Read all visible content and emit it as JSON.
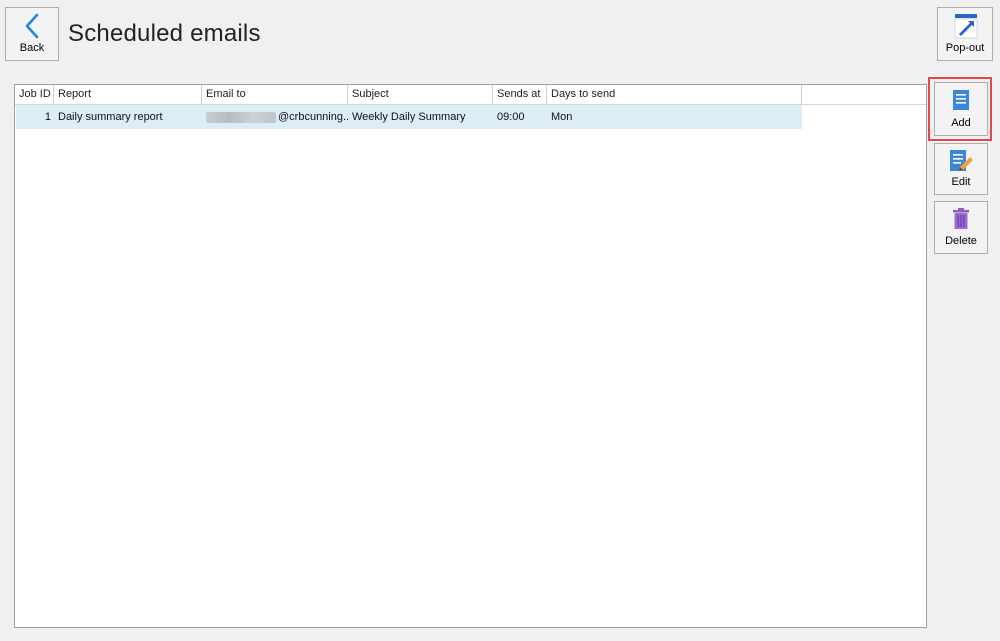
{
  "toolbar": {
    "back_label": "Back",
    "title": "Scheduled emails",
    "popout_label": "Pop-out"
  },
  "side_actions": {
    "add_label": "Add",
    "edit_label": "Edit",
    "delete_label": "Delete"
  },
  "grid": {
    "columns": [
      "Job ID",
      "Report",
      "Email to",
      "Subject",
      "Sends at",
      "Days to send"
    ],
    "rows": [
      {
        "job_id": "1",
        "report": "Daily summary report",
        "email_to_visible": "@crbcunning...",
        "subject": "Weekly Daily Summary",
        "sends_at": "09:00",
        "days_to_send": "Mon"
      }
    ]
  },
  "colors": {
    "highlight_border": "#e0484a",
    "selected_row": "#dcedf7",
    "accent_blue": "#1e88e5"
  },
  "icons": {
    "back": "chevron-left-icon",
    "popout": "popout-arrow-icon",
    "add": "document-icon",
    "edit": "document-edit-icon",
    "delete": "trash-icon"
  }
}
